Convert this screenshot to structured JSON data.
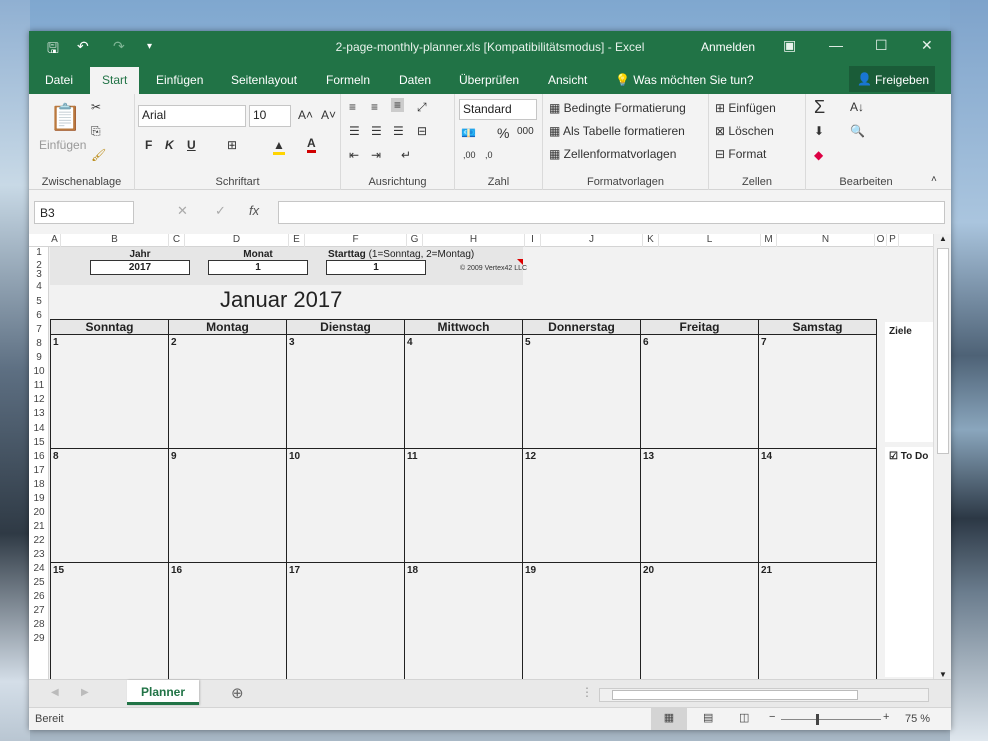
{
  "window": {
    "title": "2-page-monthly-planner.xls  [Kompatibilitätsmodus]  -  Excel",
    "signin": "Anmelden"
  },
  "tabs": [
    "Datei",
    "Start",
    "Einfügen",
    "Seitenlayout",
    "Formeln",
    "Daten",
    "Überprüfen",
    "Ansicht"
  ],
  "tell_me": "Was möchten Sie tun?",
  "share": "Freigeben",
  "ribbon": {
    "clipboard": {
      "label": "Zwischenablage",
      "paste": "Einfügen"
    },
    "font": {
      "label": "Schriftart",
      "name": "Arial",
      "size": "10",
      "bold": "F",
      "italic": "K",
      "underline": "U"
    },
    "alignment": {
      "label": "Ausrichtung"
    },
    "number": {
      "label": "Zahl",
      "format": "Standard",
      "percent": "%"
    },
    "styles": {
      "label": "Formatvorlagen",
      "conditional": "Bedingte Formatierung",
      "as_table": "Als Tabelle formatieren",
      "cell_styles": "Zellenformatvorlagen"
    },
    "cells": {
      "label": "Zellen",
      "insert": "Einfügen",
      "delete": "Löschen",
      "format": "Format"
    },
    "editing": {
      "label": "Bearbeiten"
    }
  },
  "formula_bar": {
    "name_box": "B3",
    "fx": "fx",
    "value": ""
  },
  "columns": [
    "A",
    "B",
    "C",
    "D",
    "E",
    "F",
    "G",
    "H",
    "I",
    "J",
    "K",
    "L",
    "M",
    "N",
    "O",
    "P"
  ],
  "rows": [
    "1",
    "2",
    "3",
    "4",
    "5",
    "6",
    "7",
    "8",
    "9",
    "10",
    "11",
    "12",
    "13",
    "14",
    "15",
    "16",
    "17",
    "18",
    "19",
    "20",
    "21",
    "22",
    "23",
    "24",
    "25",
    "26",
    "27",
    "28",
    "29"
  ],
  "sheet": {
    "jahr_label": "Jahr",
    "jahr_value": "2017",
    "monat_label": "Monat",
    "monat_value": "1",
    "starttag_label": "Starttag",
    "starttag_hint": "(1=Sonntag, 2=Montag)",
    "starttag_value": "1",
    "copyright": "© 2009 Vertex42 LLC",
    "month_title": "Januar 2017",
    "weekdays": [
      "Sonntag",
      "Montag",
      "Dienstag",
      "Mittwoch",
      "Donnerstag",
      "Freitag",
      "Samstag"
    ],
    "weeks": [
      [
        "1",
        "2",
        "3",
        "4",
        "5",
        "6",
        "7"
      ],
      [
        "8",
        "9",
        "10",
        "11",
        "12",
        "13",
        "14"
      ],
      [
        "15",
        "16",
        "17",
        "18",
        "19",
        "20",
        "21"
      ]
    ],
    "ziele": "Ziele",
    "todo": "☑ To Do"
  },
  "sheet_tab": "Planner",
  "status": {
    "ready": "Bereit",
    "zoom": "75 %"
  },
  "colors": {
    "excel_green": "#217346"
  }
}
